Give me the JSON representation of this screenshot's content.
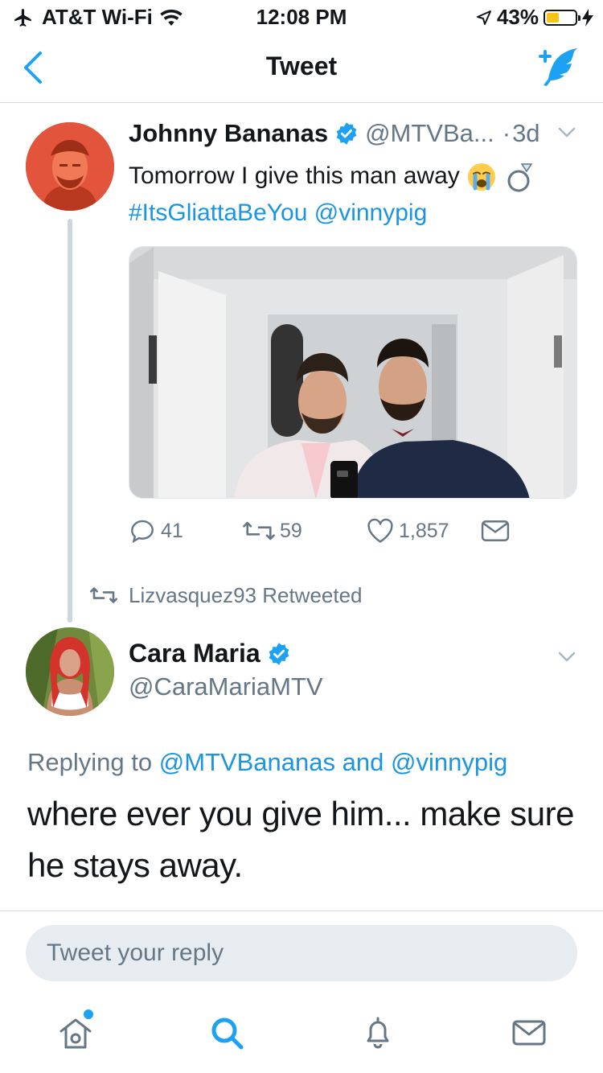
{
  "status_bar": {
    "carrier": "AT&T Wi-Fi",
    "time": "12:08 PM",
    "battery_percent": "43%",
    "battery_level": 0.43
  },
  "nav": {
    "title": "Tweet",
    "back_icon": "chevron-left-icon",
    "compose_icon": "compose-tweet-icon"
  },
  "tweet": {
    "name": "Johnny Bananas",
    "handle": "@MTVBa...",
    "dot": "·",
    "time": "3d",
    "text": "Tomorrow I give this man away",
    "hashtag": "#ItsGliattaBeYou",
    "mention": "@vinnypig",
    "emojis": [
      "crying-face-icon",
      "ring-icon"
    ],
    "reply_count": "41",
    "retweet_count": "59",
    "like_count": "1,857"
  },
  "retweet_note": "Lizvasquez93 Retweeted",
  "reply": {
    "name": "Cara Maria",
    "handle": "@CaraMariaMTV",
    "replying_prefix": "Replying to",
    "replying_to_1": "@MTVBananas",
    "replying_and": "and",
    "replying_to_2": "@vinnypig",
    "text": "where ever you give him... make sure he stays away."
  },
  "composer": {
    "placeholder": "Tweet your reply"
  },
  "tab_bar": [
    "home-icon",
    "search-icon",
    "notifications-icon",
    "messages-icon"
  ],
  "colors": {
    "accent": "#1da1f2",
    "link": "#1b95e0",
    "secondary_text": "#657786"
  }
}
